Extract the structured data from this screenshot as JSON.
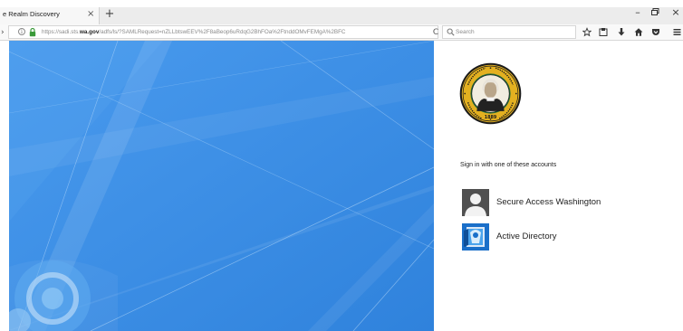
{
  "browser": {
    "tab": {
      "title": "e Realm Discovery",
      "close_glyph": "×"
    },
    "new_tab_glyph": "+",
    "window_controls": {
      "minimize": "–",
      "close": "×"
    },
    "nav": {
      "back_glyph": "›",
      "info_glyph": "i",
      "url_prefix": "https://sadi.sts.",
      "url_domain": "wa.gov",
      "url_suffix": "/adfs/ls/?SAMLRequest=nZLLbtswEEV%2F8aBeop6uRdqG2BhFOa%2FtnddOMvFEMgA%2BFC",
      "reload_glyph": "C",
      "search_placeholder": "Search",
      "toolbar_icons": [
        "star-icon",
        "library-icon",
        "download-icon",
        "home-icon",
        "pocket-icon",
        "menu-icon"
      ]
    }
  },
  "signin": {
    "prompt": "Sign in with one of these accounts",
    "accounts": [
      {
        "label": "Secure Access Washington",
        "icon": "user-silhouette-icon"
      },
      {
        "label": "Active Directory",
        "icon": "active-directory-icon"
      }
    ]
  },
  "seal": {
    "year": "1889"
  },
  "colors": {
    "panel_blue": "#3c8fe6",
    "seal_gold": "#e3b020",
    "seal_green": "#1f6b3a",
    "ad_blue": "#1a6fc9"
  }
}
